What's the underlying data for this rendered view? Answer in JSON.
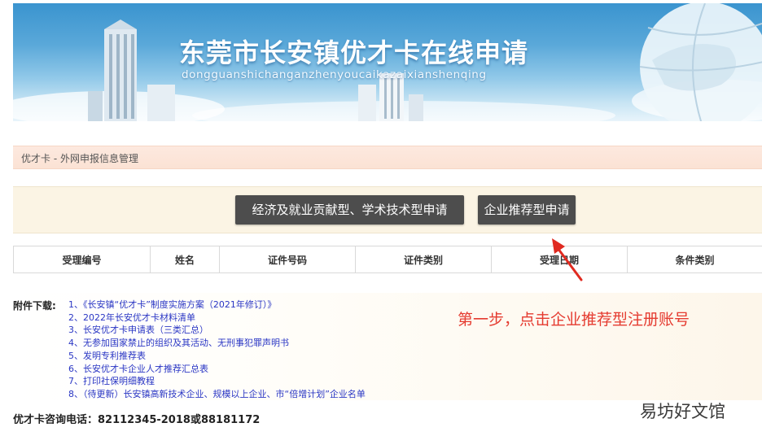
{
  "banner": {
    "title": "东莞市长安镇优才卡在线申请",
    "subtitle": "dongguanshichanganzhenyoucaikazaixianshenqing"
  },
  "breadcrumb": "优才卡 - 外网申报信息管理",
  "actions": {
    "economic_apply_label": "经济及就业贡献型、学术技术型申请",
    "enterprise_apply_label": "企业推荐型申请"
  },
  "table": {
    "headers": [
      "受理编号",
      "姓名",
      "证件号码",
      "证件类别",
      "受理日期",
      "条件类别"
    ]
  },
  "downloads": {
    "label": "附件下载:",
    "items": [
      "1、《长安镇“优才卡”制度实施方案（2021年修订）》",
      "2、2022年长安优才卡材料清单",
      "3、长安优才卡申请表（三类汇总）",
      "4、无参加国家禁止的组织及其活动、无刑事犯罪声明书",
      "5、发明专利推荐表",
      "6、长安优才卡企业人才推荐汇总表",
      "7、打印社保明细教程",
      "8、（待更新）长安镇高新技术企业、规模以上企业、市“倍增计划”企业名单"
    ]
  },
  "hotline": "优才卡咨询电话：82112345-2018或88181172",
  "annotation": "第一步，点击企业推荐型注册账号",
  "watermark": "易坊好文馆",
  "colors": {
    "button_bg": "#4d4d4d",
    "link": "#2a36c4",
    "annotation": "#e53b30",
    "breadcrumb_bg": "#fbe2d4",
    "action_bar_bg": "#fbf4e4"
  }
}
